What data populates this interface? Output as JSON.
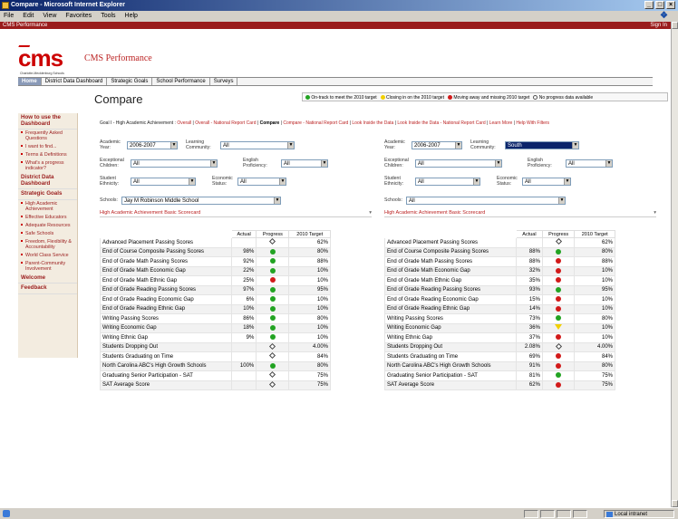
{
  "window": {
    "title": "Compare - Microsoft Internet Explorer"
  },
  "menu": [
    "File",
    "Edit",
    "View",
    "Favorites",
    "Tools",
    "Help"
  ],
  "site_bar": {
    "left": "CMS Performance",
    "right": "Sign In"
  },
  "logo": {
    "text": "cms",
    "subtext": "Charlotte-Mecklenburg Schools"
  },
  "header": {
    "title": "CMS Performance"
  },
  "nav": [
    "Home",
    "District Data Dashboard",
    "Strategic Goals",
    "School Performance",
    "Surveys"
  ],
  "sidebar": {
    "how_to": "How to use the Dashboard",
    "how_items": [
      "Frequently Asked Questions",
      "I want to find...",
      "Terms & Definitions",
      "What's a progress indicator?"
    ],
    "district": "District Data Dashboard",
    "strategic": "Strategic Goals",
    "strategic_items": [
      "High Academic Achievement",
      "Effective Educators",
      "Adequate Resources",
      "Safe Schools",
      "Freedom, Flexibility & Accountability",
      "World Class Service",
      "Parent-Community Involvement"
    ],
    "welcome": "Welcome",
    "feedback": "Feedback"
  },
  "page": {
    "title": "Compare"
  },
  "legend": [
    {
      "color": "green",
      "text": "On-track to meet the 2010 target"
    },
    {
      "color": "yellow",
      "text": "Closing in on the 2010 target"
    },
    {
      "color": "red",
      "text": "Moving away and missing 2010 target"
    },
    {
      "color": "none",
      "text": "No progress data available"
    }
  ],
  "goal": {
    "prefix": "Goal I - High Academic Achievement :",
    "links": [
      "Overall",
      "Overall - National Report Card",
      "Compare",
      "Compare - National Report Card",
      "Look Inside the Data",
      "Look Inside the Data - National Report Card",
      "Learn More",
      "Help With Filters"
    ]
  },
  "labels": {
    "year": "Academic Year:",
    "community": "Learning Community:",
    "exceptional": "Exceptional Children:",
    "english": "English Proficiency:",
    "ethnicity": "Student Ethnicity:",
    "economic": "Economic Status:",
    "schools": "Schools:",
    "scorecard": "High Academic Achievement Basic Scorecard",
    "col_actual": "Actual",
    "col_progress": "Progress",
    "col_target": "2010 Target"
  },
  "left": {
    "year": "2006-2007",
    "community": "All",
    "exceptional": "All",
    "english": "All",
    "ethnicity": "All",
    "economic": "All",
    "school": "Jay M Robinson Middle School"
  },
  "right": {
    "year": "2006-2007",
    "community": "South",
    "exceptional": "All",
    "english": "All",
    "ethnicity": "All",
    "economic": "All",
    "school": "All"
  },
  "metrics": [
    "Advanced Placement Passing Scores",
    "End of Course Composite Passing Scores",
    "End of Grade Math Passing Scores",
    "End of Grade Math Economic Gap",
    "End of Grade Math Ethnic Gap",
    "End of Grade Reading Passing Scores",
    "End of Grade Reading Economic Gap",
    "End of Grade Reading Ethnic Gap",
    "Writing Passing Scores",
    "Writing Economic Gap",
    "Writing Ethnic Gap",
    "Students Dropping Out",
    "Students Graduating on Time",
    "North Carolina ABC's High Growth Schools",
    "Graduating Senior Participation - SAT",
    "SAT Average Score"
  ],
  "left_rows": [
    {
      "actual": "",
      "progress": "none",
      "target": "62%"
    },
    {
      "actual": "98%",
      "progress": "green",
      "target": "80%"
    },
    {
      "actual": "92%",
      "progress": "green",
      "target": "88%"
    },
    {
      "actual": "22%",
      "progress": "green",
      "target": "10%"
    },
    {
      "actual": "25%",
      "progress": "red",
      "target": "10%"
    },
    {
      "actual": "97%",
      "progress": "green",
      "target": "95%"
    },
    {
      "actual": "6%",
      "progress": "green",
      "target": "10%"
    },
    {
      "actual": "10%",
      "progress": "green",
      "target": "10%"
    },
    {
      "actual": "86%",
      "progress": "green",
      "target": "80%"
    },
    {
      "actual": "18%",
      "progress": "green",
      "target": "10%"
    },
    {
      "actual": "9%",
      "progress": "green",
      "target": "10%"
    },
    {
      "actual": "",
      "progress": "none",
      "target": "4.00%"
    },
    {
      "actual": "",
      "progress": "none",
      "target": "84%"
    },
    {
      "actual": "100%",
      "progress": "green",
      "target": "80%"
    },
    {
      "actual": "",
      "progress": "none",
      "target": "75%"
    },
    {
      "actual": "",
      "progress": "none",
      "target": "75%"
    }
  ],
  "right_rows": [
    {
      "actual": "",
      "progress": "none",
      "target": "62%"
    },
    {
      "actual": "88%",
      "progress": "green",
      "target": "80%"
    },
    {
      "actual": "88%",
      "progress": "red",
      "target": "88%"
    },
    {
      "actual": "32%",
      "progress": "red",
      "target": "10%"
    },
    {
      "actual": "35%",
      "progress": "red",
      "target": "10%"
    },
    {
      "actual": "93%",
      "progress": "green",
      "target": "95%"
    },
    {
      "actual": "15%",
      "progress": "red",
      "target": "10%"
    },
    {
      "actual": "14%",
      "progress": "red",
      "target": "10%"
    },
    {
      "actual": "73%",
      "progress": "green",
      "target": "80%"
    },
    {
      "actual": "36%",
      "progress": "yellow",
      "target": "10%"
    },
    {
      "actual": "37%",
      "progress": "red",
      "target": "10%"
    },
    {
      "actual": "2.08%",
      "progress": "none",
      "target": "4.00%"
    },
    {
      "actual": "69%",
      "progress": "red",
      "target": "84%"
    },
    {
      "actual": "91%",
      "progress": "red",
      "target": "80%"
    },
    {
      "actual": "81%",
      "progress": "green",
      "target": "75%"
    },
    {
      "actual": "62%",
      "progress": "red",
      "target": "75%"
    }
  ],
  "status": {
    "zone": "Local intranet"
  }
}
